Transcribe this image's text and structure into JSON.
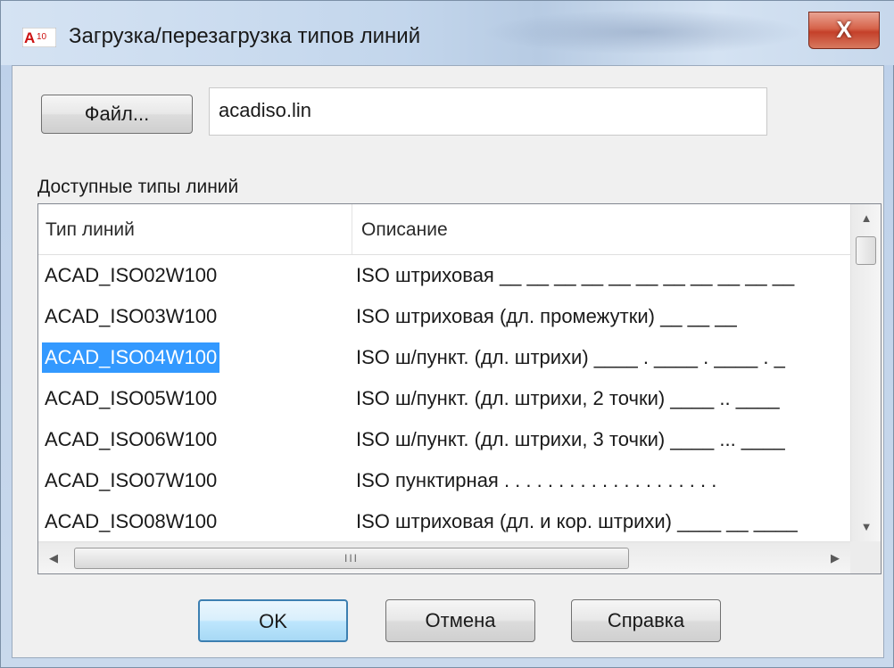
{
  "window": {
    "title": "Загрузка/перезагрузка типов линий",
    "app_icon_text": "A10",
    "close_label": "X"
  },
  "file": {
    "button_label": "Файл...",
    "filename": "acadiso.lin"
  },
  "list": {
    "group_label": "Доступные типы линий",
    "columns": [
      "Тип линий",
      "Описание"
    ],
    "rows": [
      {
        "name": "ACAD_ISO02W100",
        "description": "ISO штриховая __ __ __ __ __ __ __ __ __ __ __"
      },
      {
        "name": "ACAD_ISO03W100",
        "description": "ISO штриховая (дл. промежутки) __    __    __"
      },
      {
        "name": "ACAD_ISO04W100",
        "description": "ISO ш/пункт. (дл. штрихи) ____ . ____ . ____ . _"
      },
      {
        "name": "ACAD_ISO05W100",
        "description": "ISO ш/пункт. (дл. штрихи, 2 точки) ____ .. ____"
      },
      {
        "name": "ACAD_ISO06W100",
        "description": "ISO ш/пункт. (дл. штрихи, 3 точки) ____ ... ____"
      },
      {
        "name": "ACAD_ISO07W100",
        "description": "ISO пунктирная . . . . . . . . . . . . . . . . . . . ."
      },
      {
        "name": "ACAD_ISO08W100",
        "description": "ISO штриховая (дл. и кор. штрихи) ____ __ ____"
      }
    ],
    "selected_index": 2,
    "hscroll_grip": "III"
  },
  "buttons": {
    "ok": "OK",
    "cancel": "Отмена",
    "help": "Справка"
  },
  "colors": {
    "selection": "#3399ff",
    "close_button": "#c4402a"
  }
}
